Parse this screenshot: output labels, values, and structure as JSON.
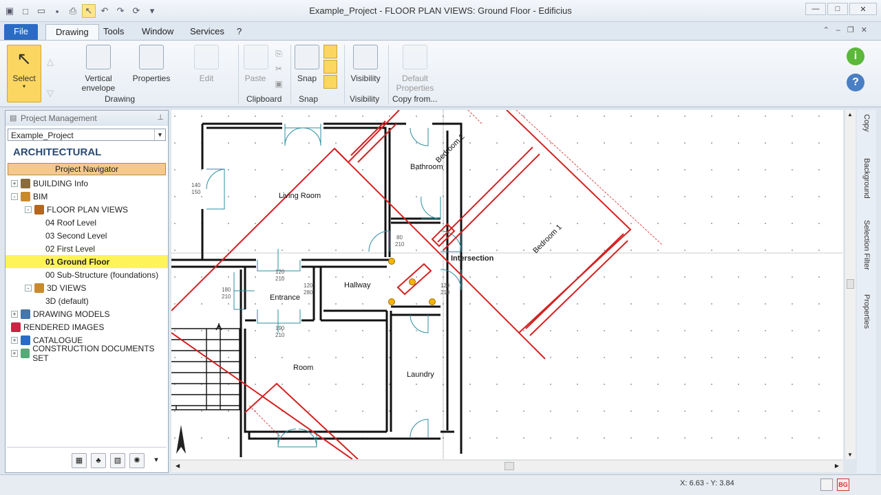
{
  "window": {
    "title": "Example_Project -  FLOOR PLAN VIEWS: Ground Floor - Edificius"
  },
  "quick_access": [
    "app-icon",
    "new-icon",
    "open-icon",
    "save-icon",
    "print-icon",
    "cursor-icon",
    "undo-icon",
    "redo-icon",
    "refresh-icon",
    "dropdown-icon"
  ],
  "menu": {
    "file": "File",
    "tabs": [
      "Drawing",
      "Tools",
      "Window",
      "Services",
      "?"
    ]
  },
  "ribbon": {
    "select": "Select",
    "vertical_envelope": "Vertical envelope",
    "properties": "Properties",
    "edit": "Edit",
    "paste": "Paste",
    "snap": "Snap",
    "visibility": "Visibility",
    "default_properties": "Default Properties",
    "groups": {
      "drawing": "Drawing",
      "clipboard": "Clipboard",
      "snap": "Snap",
      "visibility": "Visibility",
      "copy_from": "Copy from..."
    }
  },
  "panel": {
    "title": "Project Management",
    "project": "Example_Project",
    "heading": "ARCHITECTURAL",
    "navigator": "Project Navigator",
    "tree": [
      {
        "label": "BUILDING Info",
        "level": 0,
        "expander": "+"
      },
      {
        "label": "BIM",
        "level": 0,
        "expander": "-"
      },
      {
        "label": "FLOOR PLAN VIEWS",
        "level": 1,
        "expander": "-"
      },
      {
        "label": "04 Roof Level",
        "level": 2
      },
      {
        "label": "03 Second Level",
        "level": 2
      },
      {
        "label": "02 First Level",
        "level": 2
      },
      {
        "label": "01 Ground Floor",
        "level": 2,
        "selected": true
      },
      {
        "label": "00 Sub-Structure (foundations)",
        "level": 2
      },
      {
        "label": "3D VIEWS",
        "level": 1,
        "expander": "-"
      },
      {
        "label": "3D (default)",
        "level": 2
      },
      {
        "label": "DRAWING MODELS",
        "level": 0,
        "expander": "+"
      },
      {
        "label": "RENDERED IMAGES",
        "level": 0
      },
      {
        "label": "CATALOGUE",
        "level": 0,
        "expander": "+"
      },
      {
        "label": "CONSTRUCTION DOCUMENTS SET",
        "level": 0,
        "expander": "+"
      }
    ]
  },
  "plan": {
    "rooms": [
      "Bedroom 2",
      "Bathroom",
      "Living Room",
      "Bedroom 1",
      "Hallway",
      "Entrance",
      "Room",
      "Laundry"
    ],
    "snap_label": "Intersection",
    "dims": [
      "140",
      "150",
      "80",
      "210",
      "120",
      "210",
      "120",
      "280",
      "190",
      "210",
      "180",
      "210",
      "120",
      "210"
    ]
  },
  "side_tabs": [
    "Copy",
    "Background",
    "Selection Filter",
    "Properties"
  ],
  "status": {
    "coords": "X: 6.63 - Y: 3.84"
  },
  "colors": {
    "accent": "#2a6bc4",
    "highlight": "#fff35a",
    "wall": "#111111",
    "red_line": "#d42020",
    "door": "#2b8ca0"
  }
}
